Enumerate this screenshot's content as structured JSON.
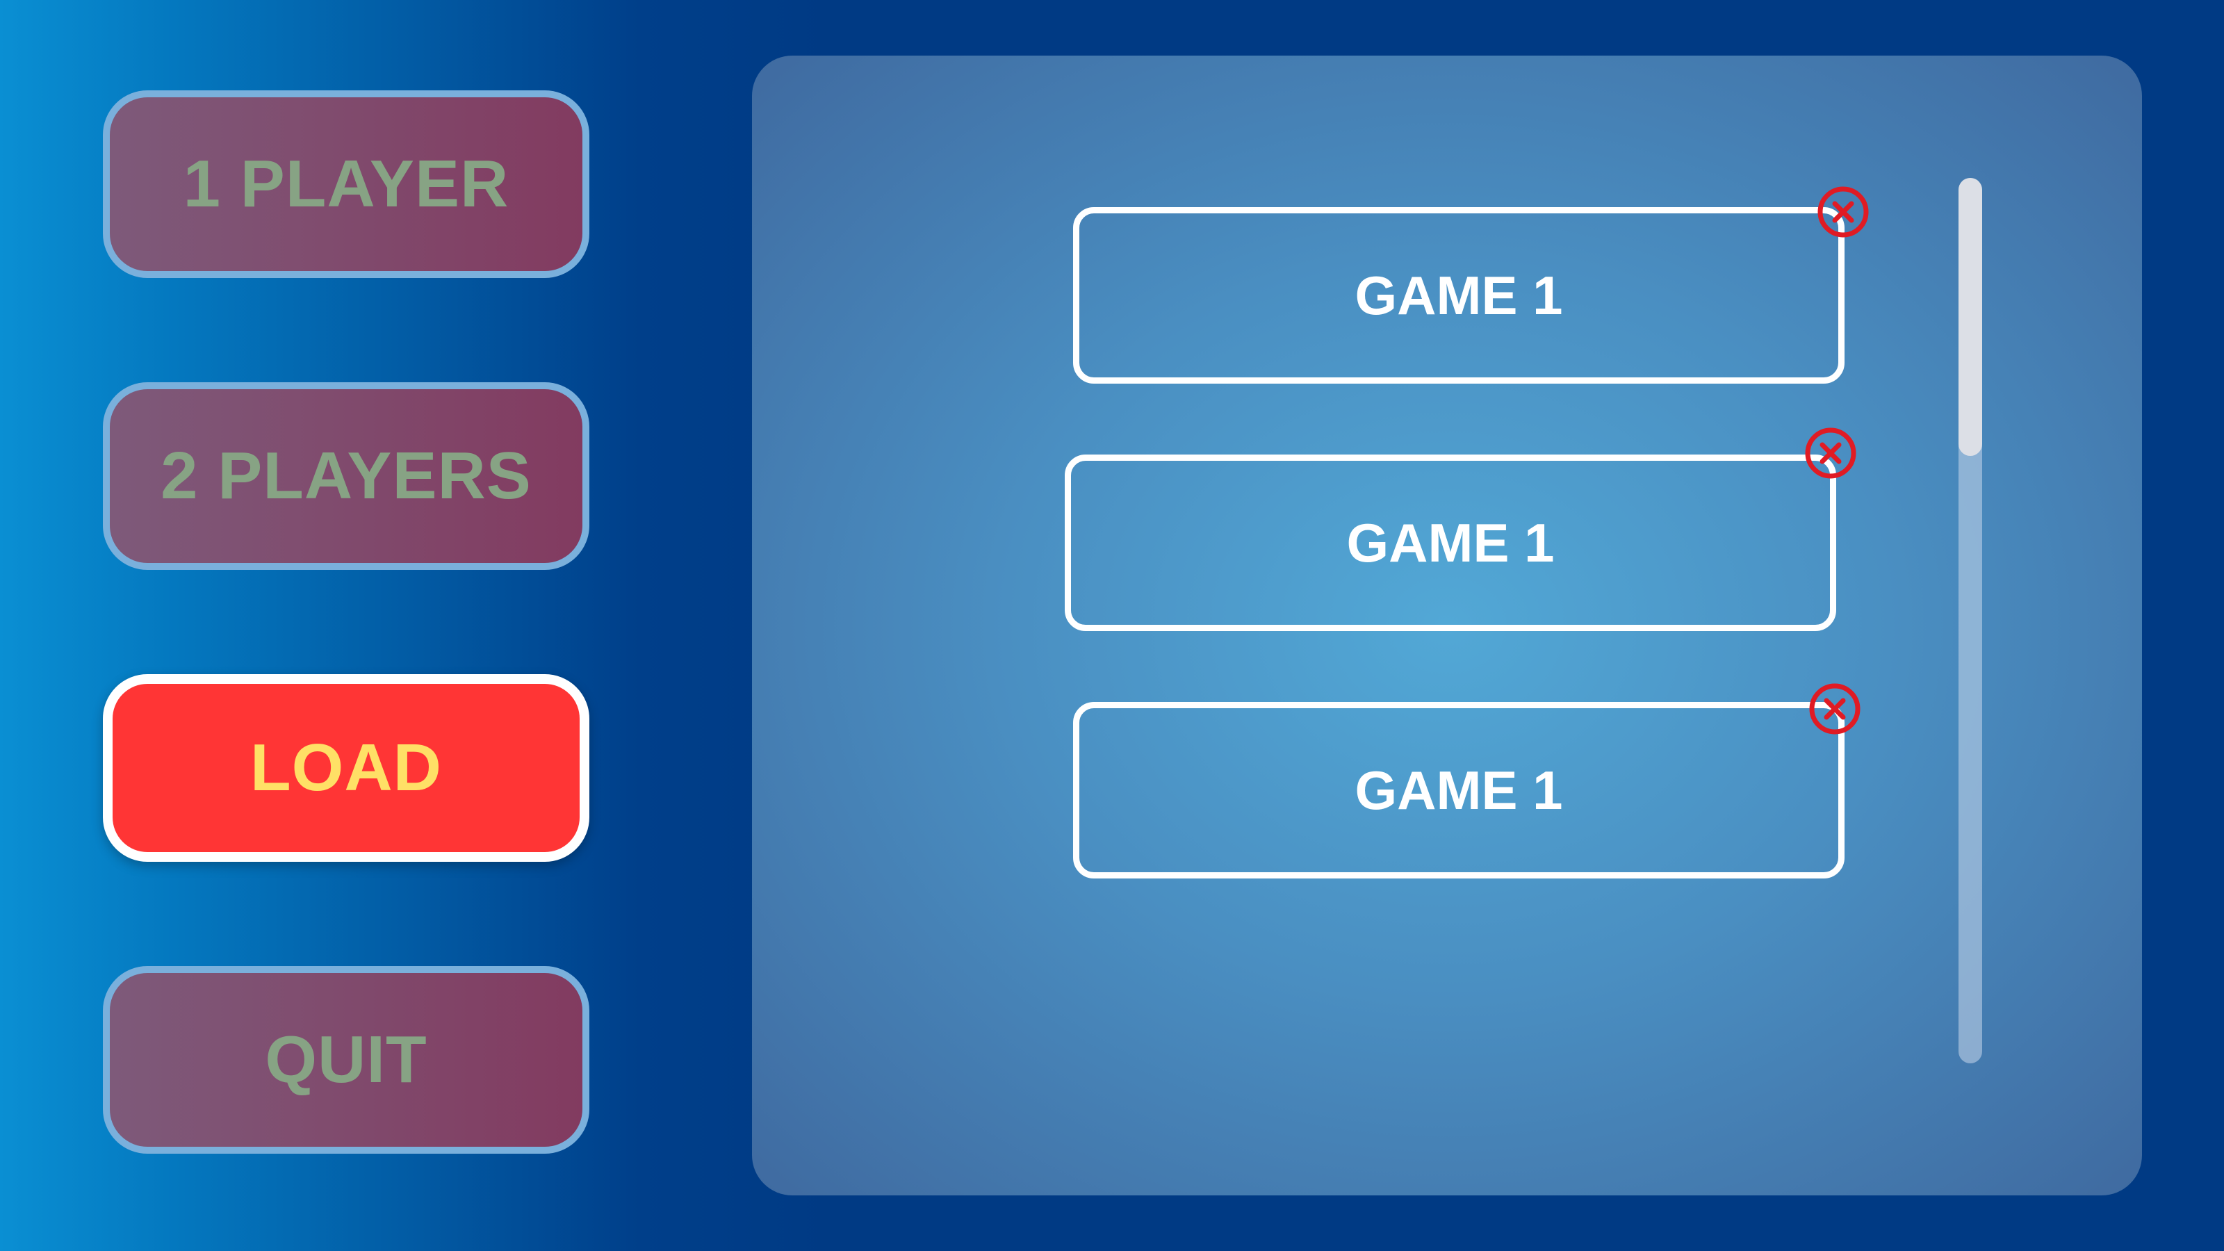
{
  "menu": {
    "one_player": "1 PLAYER",
    "two_players": "2 PLAYERS",
    "load": "LOAD",
    "quit": "QUIT",
    "active_item": "LOAD"
  },
  "saves": {
    "slots": [
      {
        "label": "GAME 1"
      },
      {
        "label": "GAME 1"
      },
      {
        "label": "GAME 1"
      }
    ],
    "delete_icon": "close-circle-icon",
    "scroll_position": 0
  },
  "colors": {
    "active_button": "#ff3535",
    "active_text": "#ffe066",
    "inactive_button": "#823b60",
    "inactive_text": "#87a384",
    "delete_icon": "#e01b24"
  }
}
